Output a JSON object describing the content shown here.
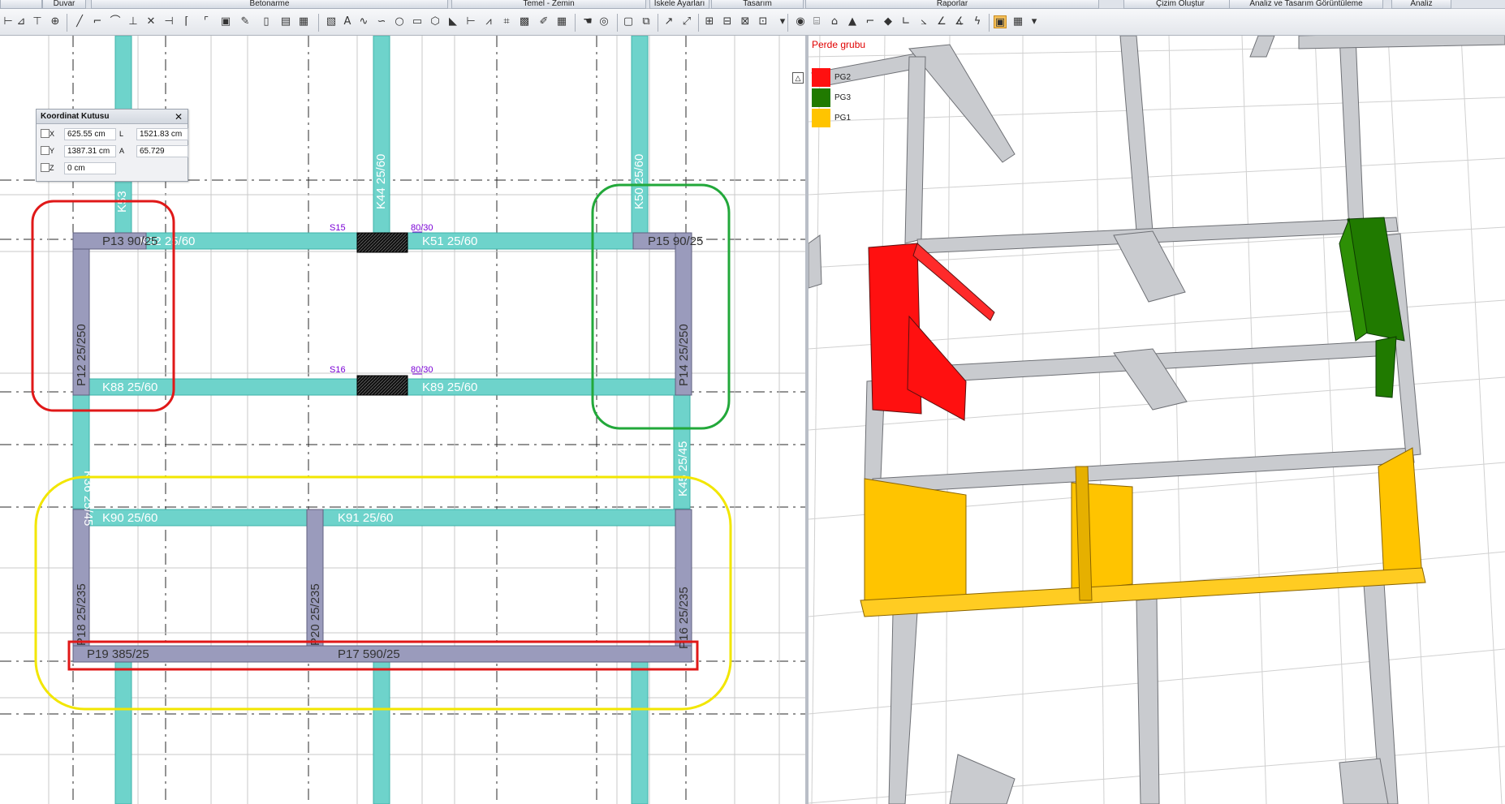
{
  "menu": {
    "tabs": [
      "Duvar",
      "Betonarme",
      "Temel - Zemin",
      "İskele Ayarları",
      "Tasarım",
      "Raporlar",
      "Çizim Oluştur",
      "Analiz ve Tasarım Görüntüleme",
      "Analiz"
    ]
  },
  "coord_box": {
    "title": "Koordinat Kutusu",
    "x_label": "X",
    "x_value": "625.55 cm",
    "y_label": "Y",
    "y_value": "1387.31 cm",
    "z_label": "Z",
    "z_value": "0 cm",
    "l_label": "L",
    "l_value": "1521.83 cm",
    "a_label": "A",
    "a_value": "65.729"
  },
  "plan": {
    "labels": {
      "k53": "K53",
      "k44": "K44 25/60",
      "k50": "K50 25/60",
      "p13": "P13 90/25",
      "k52": "K52 25/60",
      "k51": "K51 25/60",
      "p15": "P15 90/25",
      "p12": "P12 25/250",
      "p14": "P14 25/250",
      "k88": "K88 25/60",
      "k89": "K89 25/60",
      "k36": "K36 25/45",
      "k45": "K45 25/45",
      "k90": "K90 25/60",
      "k91": "K91 25/60",
      "p18": "P18 25/235",
      "p20": "P20 25/235",
      "p16": "P16 25/235",
      "p19": "P19 385/25",
      "p17": "P17 590/25",
      "s15": "S15",
      "s16": "S16",
      "ds1": "80/30",
      "ds2": "80/30"
    },
    "colors": {
      "beam": "#6ed3cb",
      "column": "#9a9bbc",
      "slab_opening": "#1a1a1a",
      "grid": "#333333",
      "red": "#e01818",
      "green": "#22a83a",
      "yellow": "#f2e600",
      "marker": "#7a00d6"
    }
  },
  "legend": {
    "title": "Perde grubu",
    "items": [
      {
        "name": "PG2",
        "color": "#ff1010"
      },
      {
        "name": "PG3",
        "color": "#207a00"
      },
      {
        "name": "PG1",
        "color": "#ffc400"
      }
    ]
  }
}
